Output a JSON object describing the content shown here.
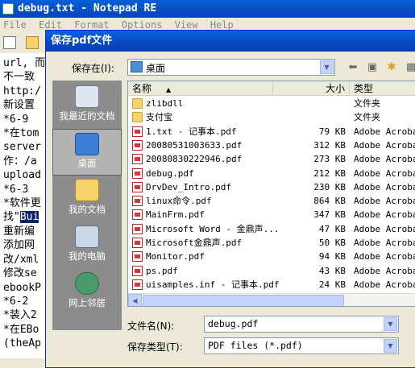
{
  "notepad": {
    "title": "debug.txt - Notepad RE",
    "menu": [
      "File",
      "Edit",
      "Format",
      "Options",
      "View",
      "Help"
    ],
    "lines": [
      "url, 而",
      "不一致",
      "http:/",
      "新设置",
      "*6-9",
      "*在tom",
      "server",
      "作：/a",
      "upload",
      "*6-3",
      "*软件更",
      "找\"",
      "重新编",
      "添加网",
      "改/xml",
      "修改se",
      "ebookP",
      "*6-2",
      "*装入2",
      "*在EBo",
      "(theAp"
    ],
    "selected_text": "Bui"
  },
  "dialog": {
    "title": "保存pdf文件",
    "save_in_label": "保存在(I):",
    "save_in_value": "桌面",
    "places": [
      {
        "label": "我最近的文档",
        "icon": "recent-documents-icon"
      },
      {
        "label": "桌面",
        "icon": "desktop-icon"
      },
      {
        "label": "我的文档",
        "icon": "my-documents-icon"
      },
      {
        "label": "我的电脑",
        "icon": "my-computer-icon"
      },
      {
        "label": "网上邻居",
        "icon": "network-places-icon"
      }
    ],
    "columns": {
      "name": "名称",
      "size": "大小",
      "type": "类型"
    },
    "files": [
      {
        "name": "zlibdll",
        "size": "",
        "type": "文件夹",
        "icon": "folder"
      },
      {
        "name": "支付宝",
        "size": "",
        "type": "文件夹",
        "icon": "folder"
      },
      {
        "name": "1.txt - 记事本.pdf",
        "size": "79 KB",
        "type": "Adobe Acrobat",
        "icon": "pdf"
      },
      {
        "name": "20080531003633.pdf",
        "size": "312 KB",
        "type": "Adobe Acrobat",
        "icon": "pdf"
      },
      {
        "name": "20080830222946.pdf",
        "size": "273 KB",
        "type": "Adobe Acrobat",
        "icon": "pdf"
      },
      {
        "name": "debug.pdf",
        "size": "212 KB",
        "type": "Adobe Acrobat",
        "icon": "pdf"
      },
      {
        "name": "DrvDev_Intro.pdf",
        "size": "230 KB",
        "type": "Adobe Acrobat",
        "icon": "pdf"
      },
      {
        "name": "linux命令.pdf",
        "size": "864 KB",
        "type": "Adobe Acrobat",
        "icon": "pdf"
      },
      {
        "name": "MainFrm.pdf",
        "size": "347 KB",
        "type": "Adobe Acrobat",
        "icon": "pdf"
      },
      {
        "name": "Microsoft Word - 金鼎声...",
        "size": "47 KB",
        "type": "Adobe Acrobat",
        "icon": "pdf"
      },
      {
        "name": "Microsoft金鼎声.pdf",
        "size": "50 KB",
        "type": "Adobe Acrobat",
        "icon": "pdf"
      },
      {
        "name": "Monitor.pdf",
        "size": "94 KB",
        "type": "Adobe Acrobat",
        "icon": "pdf"
      },
      {
        "name": "ps.pdf",
        "size": "43 KB",
        "type": "Adobe Acrobat",
        "icon": "pdf"
      },
      {
        "name": "uisamples.inf - 记事本.pdf",
        "size": "24 KB",
        "type": "Adobe Acrobat",
        "icon": "pdf"
      }
    ],
    "filename_label": "文件名(N):",
    "filename_value": "debug.pdf",
    "filetype_label": "保存类型(T):",
    "filetype_value": "PDF files (*.pdf)"
  }
}
